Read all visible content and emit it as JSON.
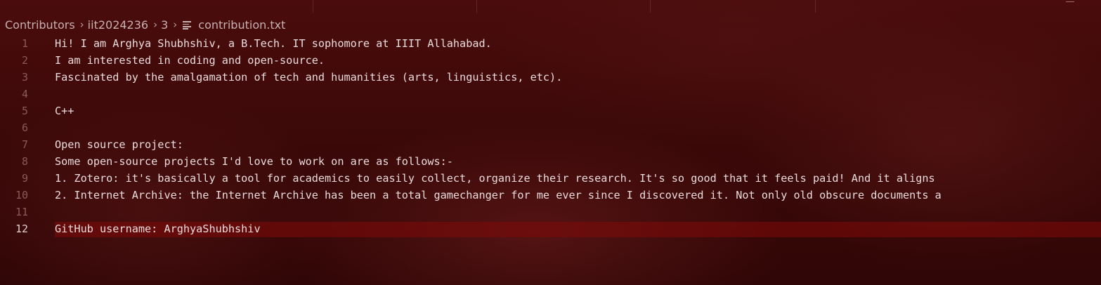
{
  "breadcrumb": {
    "items": [
      "Contributors",
      "iit2024236",
      "3"
    ],
    "file": "contribution.txt",
    "file_icon": "text-file-lines-icon",
    "separator_icon": "chevron-right-icon"
  },
  "editor": {
    "current_line": 12,
    "lines": [
      {
        "number": "1",
        "text": "Hi! I am Arghya Shubhshiv, a B.Tech. IT sophomore at IIIT Allahabad."
      },
      {
        "number": "2",
        "text": "I am interested in coding and open-source."
      },
      {
        "number": "3",
        "text": "Fascinated by the amalgamation of tech and humanities (arts, linguistics, etc)."
      },
      {
        "number": "4",
        "text": ""
      },
      {
        "number": "5",
        "text": "C++"
      },
      {
        "number": "6",
        "text": ""
      },
      {
        "number": "7",
        "text": "Open source project:"
      },
      {
        "number": "8",
        "text": "Some open-source projects I'd love to work on are as follows:-"
      },
      {
        "number": "9",
        "text": "1. Zotero: it's basically a tool for academics to easily collect, organize their research. It's so good that it feels paid! And it aligns"
      },
      {
        "number": "10",
        "text": "2. Internet Archive: the Internet Archive has been a total gamechanger for me ever since I discovered it. Not only old obscure documents a"
      },
      {
        "number": "11",
        "text": ""
      },
      {
        "number": "12",
        "text": "GitHub username:  ArghyaShubhshiv"
      }
    ]
  },
  "colors": {
    "background": "#3e0909",
    "text": "#eadcdc",
    "line_number": "#8c5a5a",
    "current_line_highlight": "#820a0a"
  }
}
